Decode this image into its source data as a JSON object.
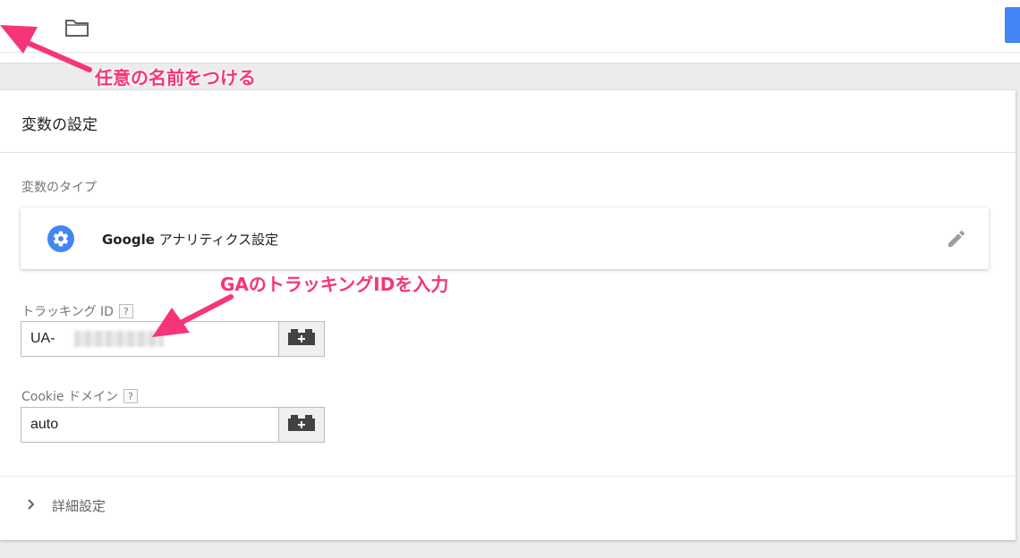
{
  "topbar": {
    "folder_icon": "folder-icon",
    "accent": "#4285f4"
  },
  "card": {
    "title": "変数の設定",
    "variable_type_label": "変数のタイプ",
    "variable_type": {
      "icon": "gear-icon",
      "name_bold": "Google",
      "name_rest": " アナリティクス設定",
      "edit_icon": "pencil-icon"
    },
    "tracking_id": {
      "label": "トラッキング ID",
      "help": "?",
      "value": "UA-"
    },
    "cookie_domain": {
      "label": "Cookie ドメイン",
      "help": "?",
      "value": "auto"
    },
    "advanced": {
      "label": "詳細設定",
      "icon": "chevron-right-icon"
    }
  },
  "annotations": {
    "name_hint": "任意の名前をつける",
    "tracking_hint": "GAのトラッキングIDを入力",
    "color": "#f7347a"
  }
}
